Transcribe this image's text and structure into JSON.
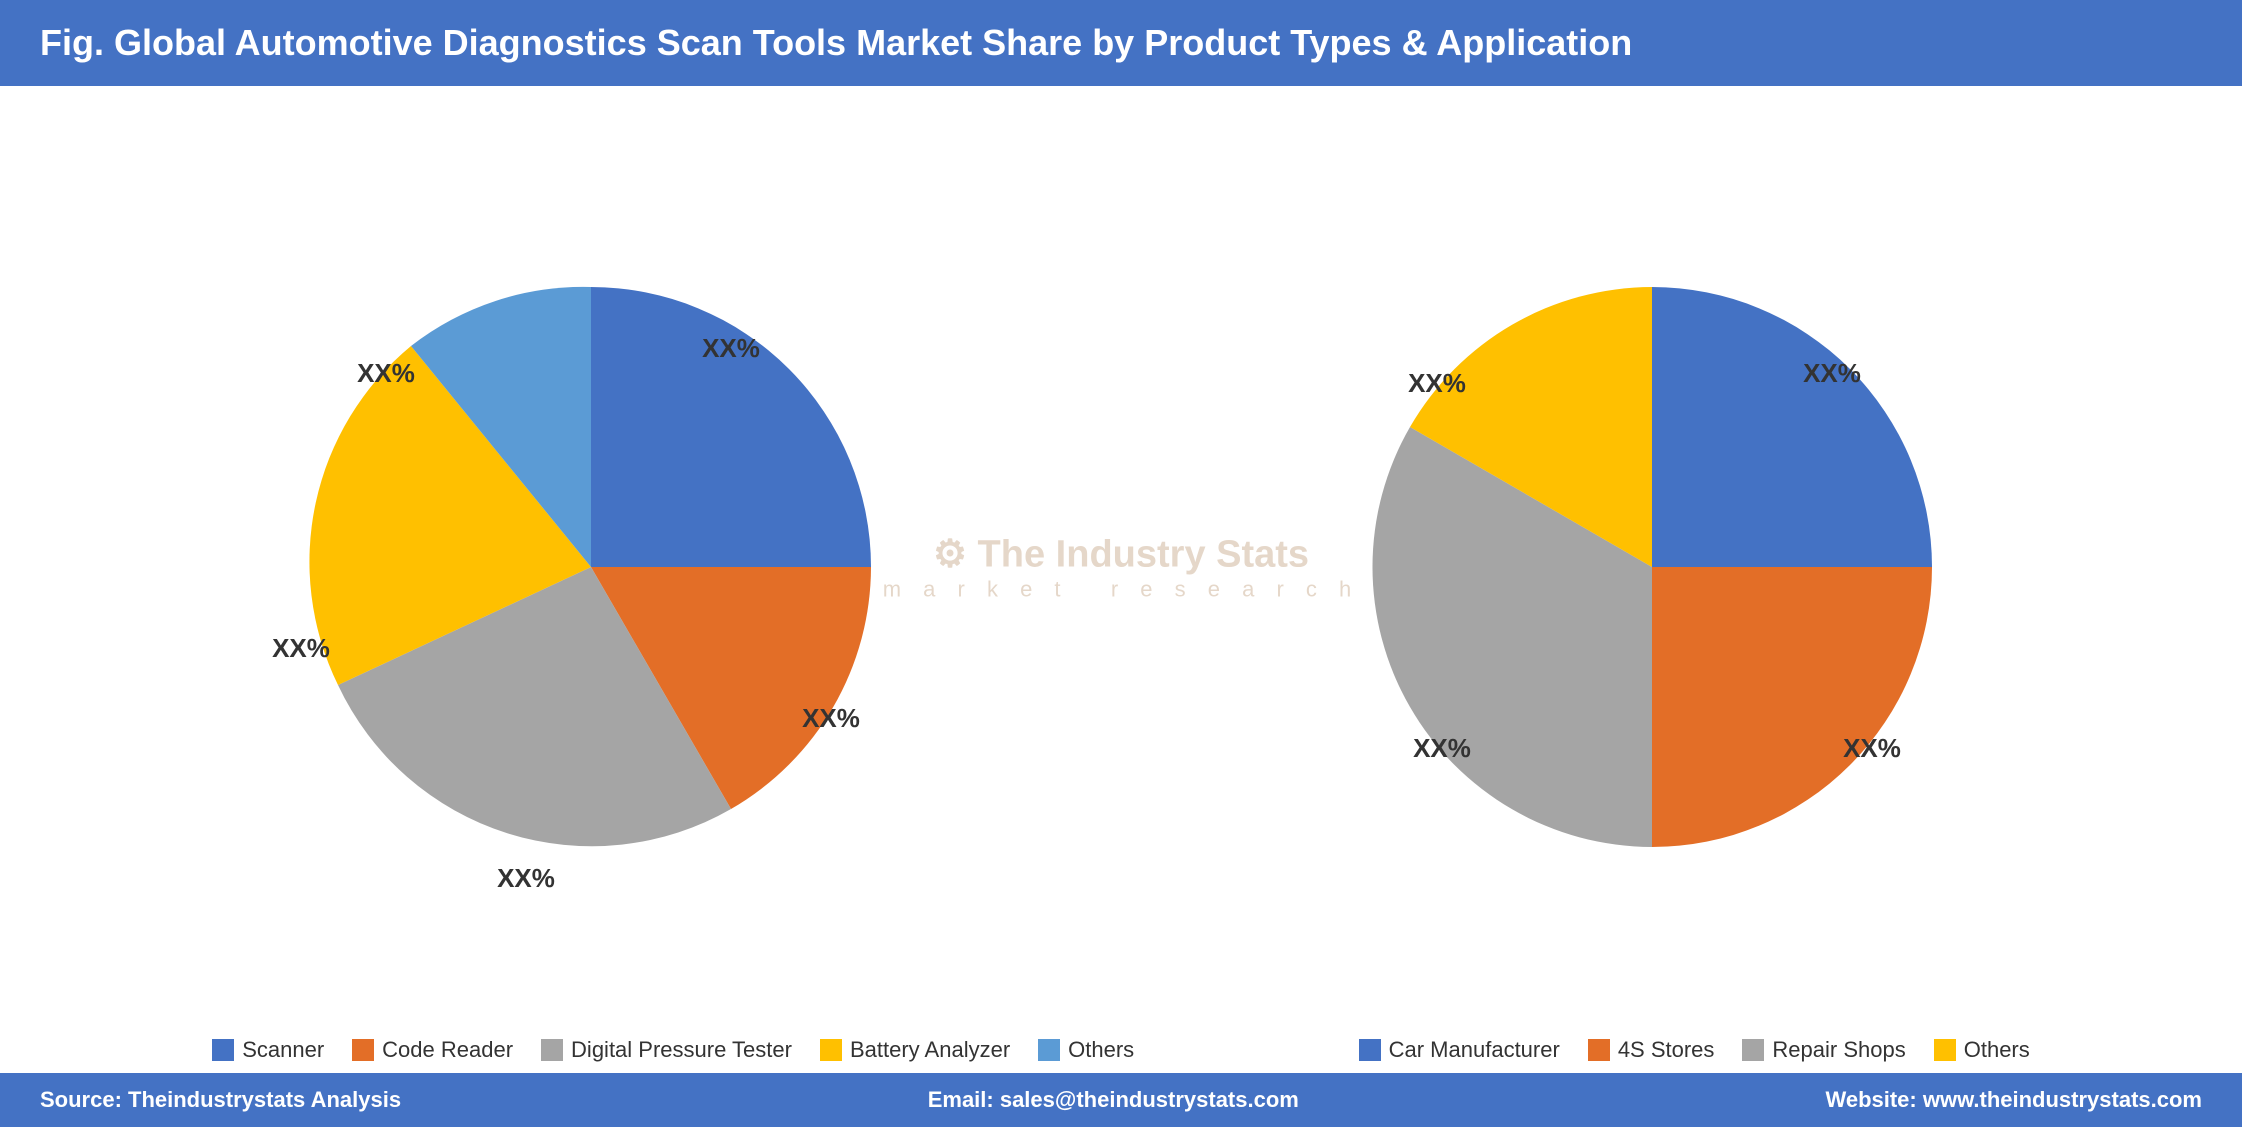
{
  "header": {
    "title": "Fig. Global Automotive Diagnostics Scan Tools Market Share by Product Types & Application"
  },
  "watermark": {
    "line1": "⚙ The Industry Stats",
    "line2": "m a r k e t   r e s e a r c h"
  },
  "chart1": {
    "title": "Product Types",
    "labels": {
      "scanner": "XX%",
      "codeReader": "XX%",
      "digitalPressureTester": "XX%",
      "batteryAnalyzer": "XX%",
      "others": "XX%"
    },
    "segments": [
      {
        "name": "Scanner",
        "color": "#4472c4",
        "startAngle": -90,
        "endAngle": 0
      },
      {
        "name": "Code Reader",
        "color": "#e36e27",
        "startAngle": 0,
        "endAngle": 60
      },
      {
        "name": "Digital Pressure Tester",
        "color": "#a5a5a5",
        "startAngle": 60,
        "endAngle": 155
      },
      {
        "name": "Battery Analyzer",
        "color": "#ffc000",
        "startAngle": 155,
        "endAngle": 230
      },
      {
        "name": "Others",
        "color": "#5b9bd5",
        "startAngle": 230,
        "endAngle": 270
      }
    ]
  },
  "chart2": {
    "title": "Application",
    "labels": {
      "carManufacturer": "XX%",
      "fourSStores": "XX%",
      "repairShops": "XX%",
      "others": "XX%"
    },
    "segments": [
      {
        "name": "Car Manufacturer",
        "color": "#4472c4",
        "startAngle": -90,
        "endAngle": 0
      },
      {
        "name": "4S Stores",
        "color": "#e36e27",
        "startAngle": 0,
        "endAngle": 90
      },
      {
        "name": "Repair Shops",
        "color": "#a5a5a5",
        "startAngle": 90,
        "endAngle": 210
      },
      {
        "name": "Others",
        "color": "#ffc000",
        "startAngle": 210,
        "endAngle": 270
      }
    ]
  },
  "legend1": {
    "items": [
      {
        "label": "Scanner",
        "color": "#4472c4"
      },
      {
        "label": "Code Reader",
        "color": "#e36e27"
      },
      {
        "label": "Digital Pressure Tester",
        "color": "#a5a5a5"
      },
      {
        "label": "Battery Analyzer",
        "color": "#ffc000"
      },
      {
        "label": "Others",
        "color": "#5b9bd5"
      }
    ]
  },
  "legend2": {
    "items": [
      {
        "label": "Car Manufacturer",
        "color": "#4472c4"
      },
      {
        "label": "4S Stores",
        "color": "#e36e27"
      },
      {
        "label": "Repair Shops",
        "color": "#a5a5a5"
      },
      {
        "label": "Others",
        "color": "#ffc000"
      }
    ]
  },
  "footer": {
    "source": "Source: Theindustrystats Analysis",
    "email": "Email: sales@theindustrystats.com",
    "website": "Website: www.theindustrystats.com"
  }
}
